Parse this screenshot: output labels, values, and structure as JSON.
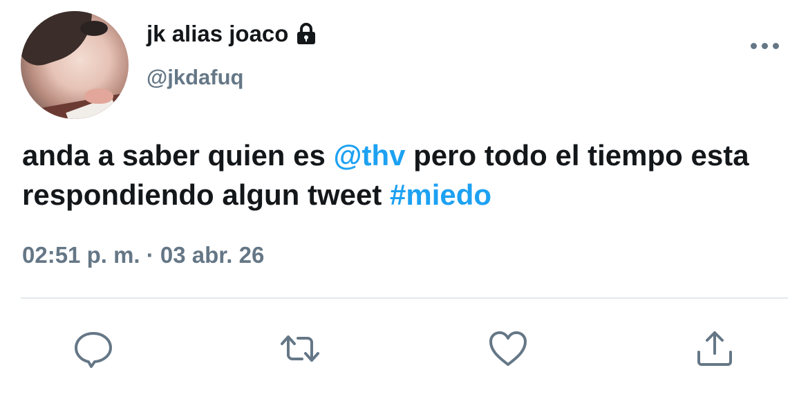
{
  "tweet": {
    "author": {
      "display_name": "jk alias joaco",
      "handle": "@jkdafuq",
      "protected_icon": "lock-icon"
    },
    "body": {
      "part1": "anda a saber quien es ",
      "mention": "@thv",
      "part2": " pero todo el tiempo esta respondiendo algun tweet ",
      "hashtag": "#miedo"
    },
    "timestamp": "02:51 p. m. · 03 abr. 26",
    "actions": {
      "reply_icon": "speech-bubble-icon",
      "retweet_icon": "retweet-icon",
      "like_icon": "heart-icon",
      "share_icon": "share-upload-icon"
    },
    "menu_icon": "more-options-icon"
  },
  "colors": {
    "text": "#14171a",
    "secondary": "#657786",
    "link": "#1da1f2",
    "divider": "#e1e8ed"
  }
}
